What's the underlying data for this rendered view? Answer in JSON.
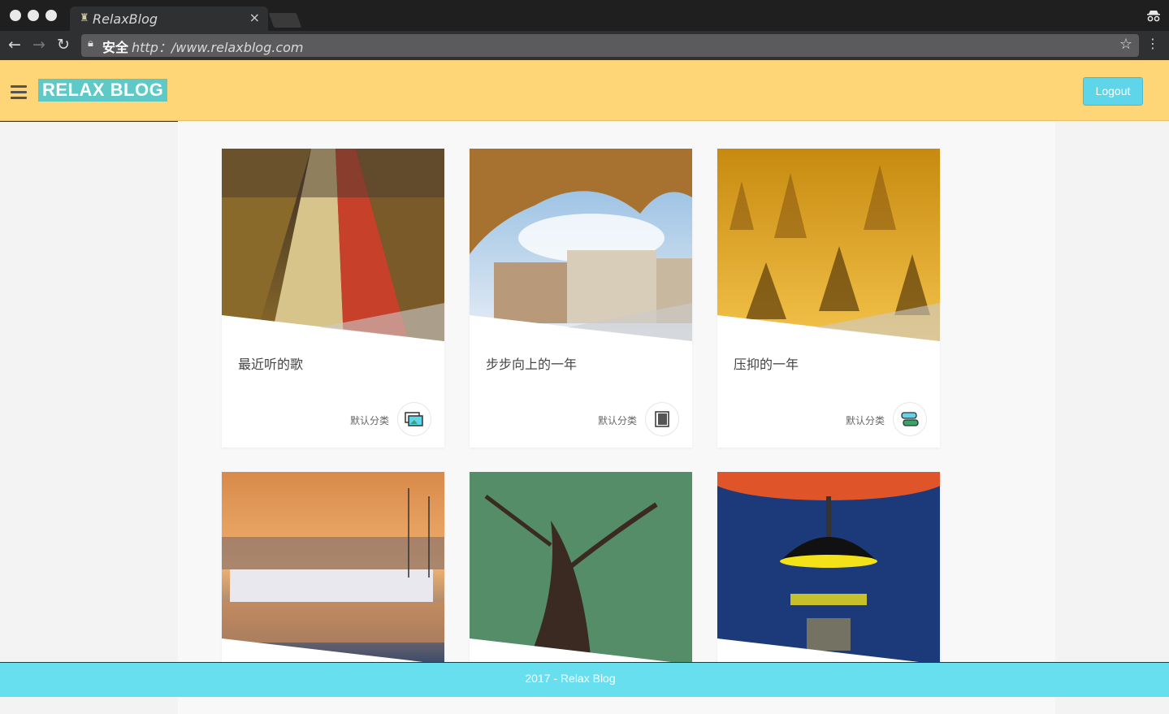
{
  "browser": {
    "tab_title": "RelaxBlog",
    "tab_close": "×",
    "secure_label": "安全",
    "url": "http：/www.relaxblog.com",
    "icons": [
      "back-icon",
      "forward-icon",
      "reload-icon",
      "lock-icon",
      "star-icon",
      "menu-icon",
      "incognito-icon"
    ]
  },
  "header": {
    "brand": "RELAX BLOG",
    "logout_label": "Logout",
    "colors": {
      "header_bg": "#ffd677",
      "brand_bg": "#5ec9c6",
      "logout_bg": "#5fd5ea"
    }
  },
  "cards": [
    {
      "title": "最近听的歌",
      "category": "默认分类",
      "icon": "image-gallery-icon"
    },
    {
      "title": "步步向上的一年",
      "category": "默认分类",
      "icon": "book-icon"
    },
    {
      "title": "压抑的一年",
      "category": "默认分类",
      "icon": "chat-bubbles-icon"
    },
    {
      "title": "",
      "category": "",
      "icon": ""
    },
    {
      "title": "",
      "category": "",
      "icon": ""
    },
    {
      "title": "",
      "category": "",
      "icon": ""
    }
  ],
  "footer": {
    "text": "2017 - Relax Blog",
    "color": "#68dfef"
  }
}
